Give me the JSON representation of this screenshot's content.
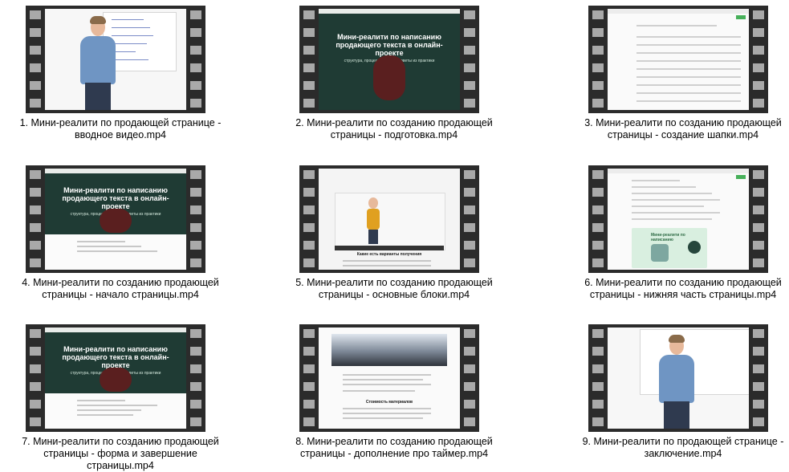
{
  "items": [
    {
      "caption1": "1. Мини-реалити по продающей странице -",
      "caption2": "вводное видео.mp4",
      "caption3": ""
    },
    {
      "caption1": "2. Мини-реалити по созданию продающей",
      "caption2": "страницы - подготовка.mp4",
      "caption3": ""
    },
    {
      "caption1": "3. Мини-реалити по созданию продающей",
      "caption2": "страницы - создание шапки.mp4",
      "caption3": ""
    },
    {
      "caption1": "4. Мини-реалити по созданию продающей",
      "caption2": "страницы - начало страницы.mp4",
      "caption3": ""
    },
    {
      "caption1": "5. Мини-реалити по созданию продающей",
      "caption2": "страницы - основные блоки.mp4",
      "caption3": ""
    },
    {
      "caption1": "6. Мини-реалити по созданию продающей",
      "caption2": "страницы - нижняя часть страницы.mp4",
      "caption3": ""
    },
    {
      "caption1": "7. Мини-реалити по созданию продающей",
      "caption2": "страницы - форма и завершение",
      "caption3": "страницы.mp4"
    },
    {
      "caption1": "8. Мини-реалити по созданию продающей",
      "caption2": "страницы - дополнение про таймер.mp4",
      "caption3": ""
    },
    {
      "caption1": "9. Мини-реалити по продающей странице -",
      "caption2": "заключение.mp4",
      "caption3": ""
    }
  ],
  "thumbs": {
    "hero_title": "Мини-реалити по написанию продающего текста в онлайн-проекте",
    "hero_subtitle": "структура, процесс, нюансы, советы из практики",
    "video_heading": "Какие есть варианты получения",
    "doc_banner": "Мини-реалити по написанию",
    "timer_heading": "Стоимость материалов"
  },
  "colors": {
    "film": "#2b2b2b",
    "hero_bg": "#1f3b34",
    "accent_green": "#47b05a"
  }
}
